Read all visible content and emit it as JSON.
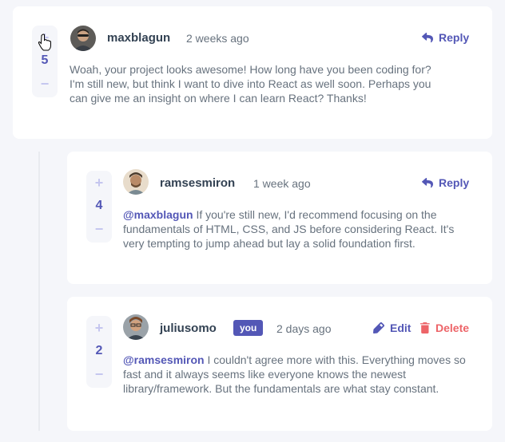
{
  "comments": [
    {
      "score": "5",
      "username": "maxblagun",
      "time": "2 weeks ago",
      "reply_label": "Reply",
      "text": "Woah, your project looks awesome! How long have you been coding for? I'm still new, but think I want to dive into React as well soon. Perhaps you can give me an insight on where I can learn React? Thanks!"
    },
    {
      "score": "4",
      "username": "ramsesmiron",
      "time": "1 week ago",
      "reply_label": "Reply",
      "mention": "@maxblagun",
      "text": "If you're still new, I'd recommend focusing on the fundamentals of HTML, CSS, and JS before considering React. It's very tempting to jump ahead but lay a solid foundation first."
    },
    {
      "score": "2",
      "username": "juliusomo",
      "badge": "you",
      "time": "2 days ago",
      "edit_label": "Edit",
      "delete_label": "Delete",
      "mention": "@ramsesmiron",
      "text": "I couldn't agree more with this. Everything moves so fast and it always seems like everyone knows the newest library/framework. But the fundamentals are what stay constant."
    }
  ],
  "vote": {
    "plus": "+",
    "minus": "−"
  },
  "colors": {
    "accent": "#5357b6",
    "danger": "#ed6468",
    "vote_symbol": "#c5c6ef",
    "background": "#f5f6fa",
    "heading": "#334253",
    "body_text": "#67727e"
  },
  "icons": {
    "reply": "reply-arrow-icon",
    "edit": "pencil-icon",
    "delete": "trash-icon"
  }
}
